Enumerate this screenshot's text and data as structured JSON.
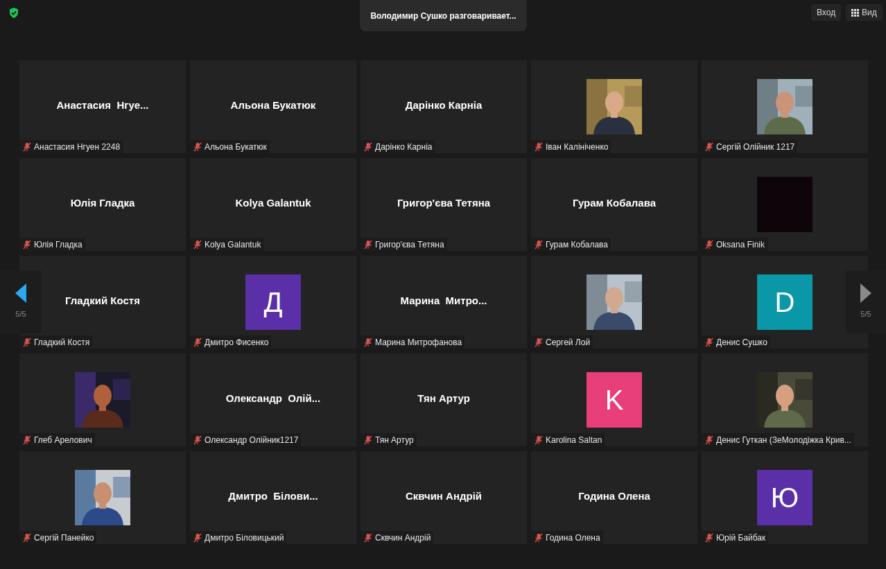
{
  "security": {
    "verified": true
  },
  "speaker_banner": "Володимир Сушко разговаривает...",
  "top_buttons": [
    {
      "label": "Вход",
      "kind": "text"
    },
    {
      "label": "Вид",
      "kind": "grid"
    }
  ],
  "pager": {
    "left": {
      "label": "5/5",
      "enabled": true
    },
    "right": {
      "label": "5/5",
      "enabled": false
    }
  },
  "tiles": [
    {
      "kind": "name",
      "display": "Анастасия  Нгуе...",
      "label": "Анастасия Нгуен 2248",
      "muted": true
    },
    {
      "kind": "name",
      "display": "Альона Букатюк",
      "label": "Альона Букатюк",
      "muted": true
    },
    {
      "kind": "name",
      "display": "Дарінко Карніа",
      "label": "Дарінко Карніа",
      "muted": true
    },
    {
      "label": "Іван Калініченко",
      "muted": true
    },
    {
      "label": "Сергій Олійник 1217",
      "muted": true
    },
    {
      "kind": "name",
      "display": "Юлія Гладка",
      "label": "Юлія Гладка",
      "muted": true
    },
    {
      "kind": "name",
      "display": "Kolya Galantuk",
      "label": "Kolya Galantuk",
      "muted": true
    },
    {
      "kind": "name",
      "display": "Григор'єва Тетяна",
      "label": "Григор'єва Тетяна",
      "muted": true
    },
    {
      "kind": "name",
      "display": "Гурам Кобалава",
      "label": "Гурам Кобалава",
      "muted": true
    },
    {
      "kind": "blank",
      "label": "Oksana Finik",
      "muted": true
    },
    {
      "kind": "name",
      "display": "Гладкий Костя",
      "label": "Гладкий Костя",
      "muted": true
    },
    {
      "kind": "letter",
      "letter": "Д",
      "color": "#5b2fa8",
      "label": "Дмитро Фисенко",
      "muted": true
    },
    {
      "kind": "name",
      "display": "Марина  Митро...",
      "label": "Марина Митрофанова",
      "muted": true
    },
    {
      "label": "Сергей Лой",
      "muted": true
    },
    {
      "kind": "letter",
      "letter": "D",
      "color": "#0a97a7",
      "label": "Денис Сушко",
      "muted": true
    },
    {
      "label": "Глеб Арелович",
      "muted": true
    },
    {
      "kind": "name",
      "display": "Олександр  Олій...",
      "label": "Олександр Олійник1217",
      "muted": true
    },
    {
      "kind": "name",
      "display": "Тян Артур",
      "label": "Тян Артур",
      "muted": true
    },
    {
      "kind": "letter",
      "letter": "K",
      "color": "#e83e79",
      "label": "Karolina Saltan",
      "muted": true
    },
    {
      "label": "Денис Гуткан (ЗеМолодіжка Крив...",
      "muted": true
    },
    {
      "label": "Сергій Панейко",
      "muted": true
    },
    {
      "kind": "name",
      "display": "Дмитро  Білови...",
      "label": "Дмитро Біловицький",
      "muted": true
    },
    {
      "kind": "name",
      "display": "Сквчин Андрій",
      "label": "Сквчин Андрій",
      "muted": true
    },
    {
      "kind": "name",
      "display": "Година Олена",
      "label": "Година Олена",
      "muted": true
    },
    {
      "kind": "letter",
      "letter": "Ю",
      "color": "#5b2fa8",
      "label": "Юрій Байбак",
      "muted": true
    }
  ]
}
